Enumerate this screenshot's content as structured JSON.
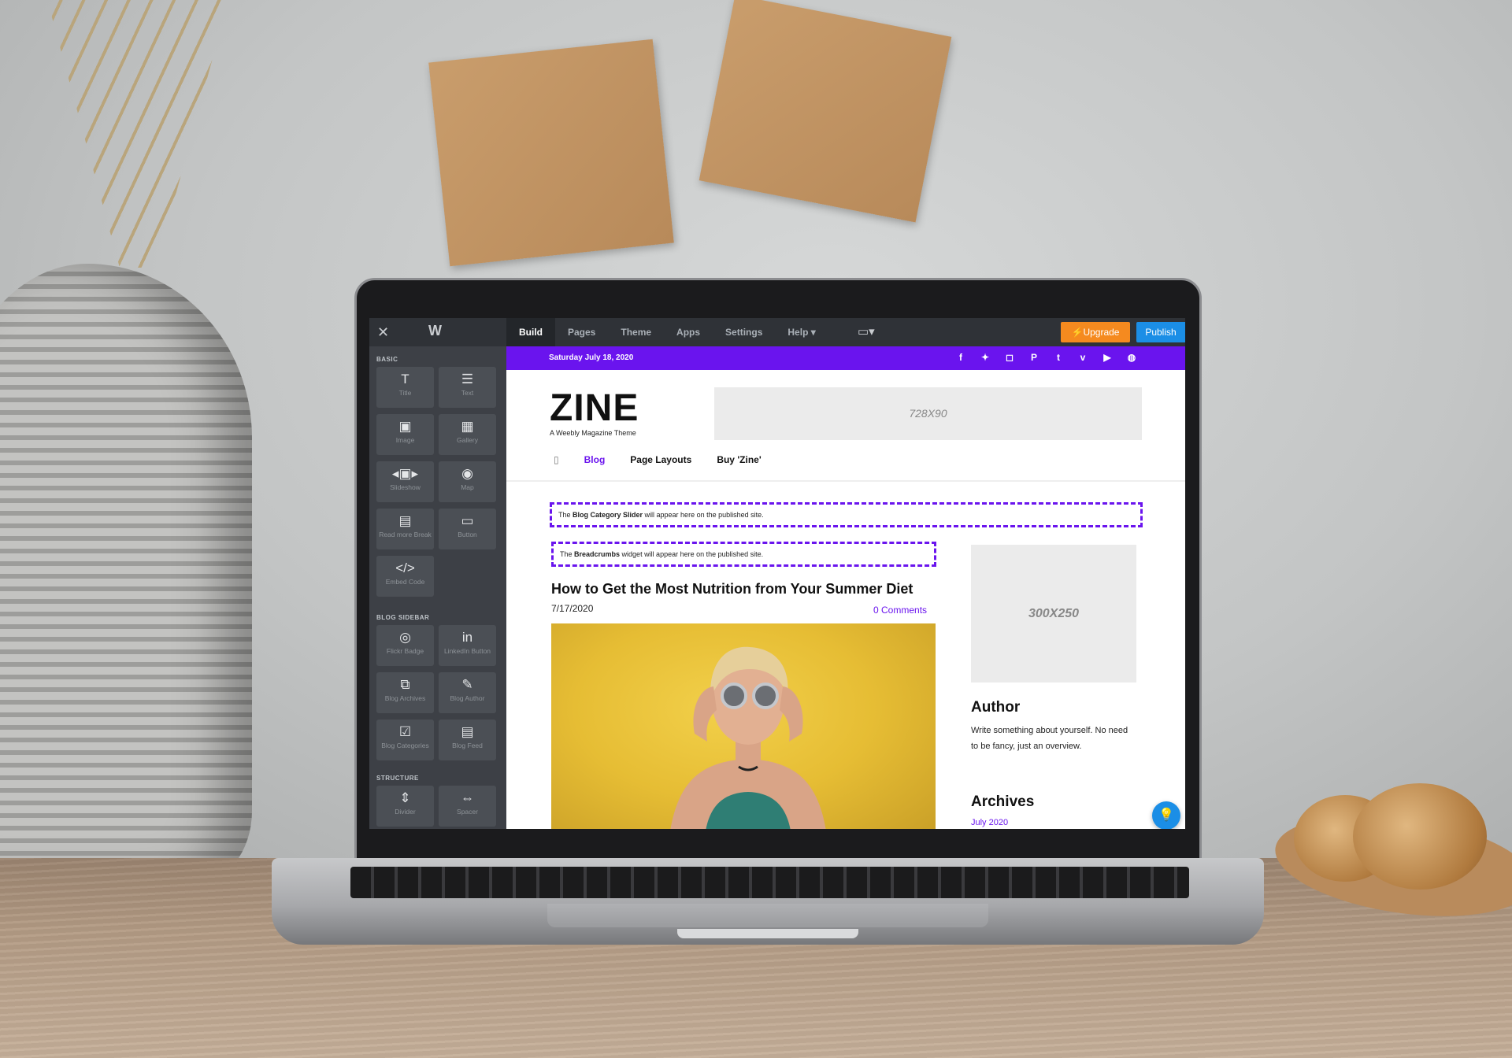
{
  "editor": {
    "nav": [
      "Build",
      "Pages",
      "Theme",
      "Apps",
      "Settings",
      "Help ▾"
    ],
    "upgrade_label": "Upgrade",
    "publish_label": "Publish"
  },
  "sidebar": {
    "sections": {
      "basic": "BASIC",
      "blog_sidebar": "BLOG SIDEBAR",
      "structure": "STRUCTURE"
    },
    "basic_tiles": [
      {
        "label": "Title",
        "icon": "title-icon"
      },
      {
        "label": "Text",
        "icon": "text-icon"
      },
      {
        "label": "Image",
        "icon": "image-icon"
      },
      {
        "label": "Gallery",
        "icon": "gallery-icon"
      },
      {
        "label": "Slideshow",
        "icon": "slideshow-icon"
      },
      {
        "label": "Map",
        "icon": "map-icon"
      },
      {
        "label": "Read more Break",
        "icon": "read-more-icon"
      },
      {
        "label": "Button",
        "icon": "button-icon"
      },
      {
        "label": "Embed Code",
        "icon": "embed-code-icon"
      }
    ],
    "blog_tiles": [
      {
        "label": "Flickr Badge",
        "icon": "flickr-icon"
      },
      {
        "label": "LinkedIn Button",
        "icon": "linkedin-icon"
      },
      {
        "label": "Blog Archives",
        "icon": "archives-icon"
      },
      {
        "label": "Blog Author",
        "icon": "author-icon"
      },
      {
        "label": "Blog Categories",
        "icon": "categories-icon"
      },
      {
        "label": "Blog Feed",
        "icon": "feed-icon"
      }
    ],
    "structure_tiles": [
      {
        "label": "Divider",
        "icon": "divider-icon"
      },
      {
        "label": "Spacer",
        "icon": "spacer-icon"
      }
    ]
  },
  "site": {
    "date": "Saturday July 18, 2020",
    "brand": "ZINE",
    "tagline": "A Weebly Magazine Theme",
    "ad_top": "728X90",
    "menu": [
      "Blog",
      "Page Layouts",
      "Buy 'Zine'"
    ],
    "slider_notice": {
      "pre": "The ",
      "bold": "Blog Category Slider",
      "post": " will appear here on the published site."
    },
    "breadcrumbs_notice": {
      "pre": "The ",
      "bold": "Breadcrumbs",
      "post": " widget will appear here on the published site."
    },
    "post": {
      "title": "How to Get the Most Nutrition from Your Summer Diet",
      "date": "7/17/2020",
      "comments": "0 Comments"
    },
    "ad_side": "300X250",
    "author": {
      "title": "Author",
      "text": "Write something about yourself. No need to be fancy, just an overview."
    },
    "archives": {
      "title": "Archives",
      "link": "July 2020"
    }
  },
  "colors": {
    "accent": "#6a14ee",
    "upgrade": "#f58a1f",
    "publish": "#1b8ee6",
    "editor_bar": "#2f3237",
    "sidebar": "#3d4046"
  }
}
